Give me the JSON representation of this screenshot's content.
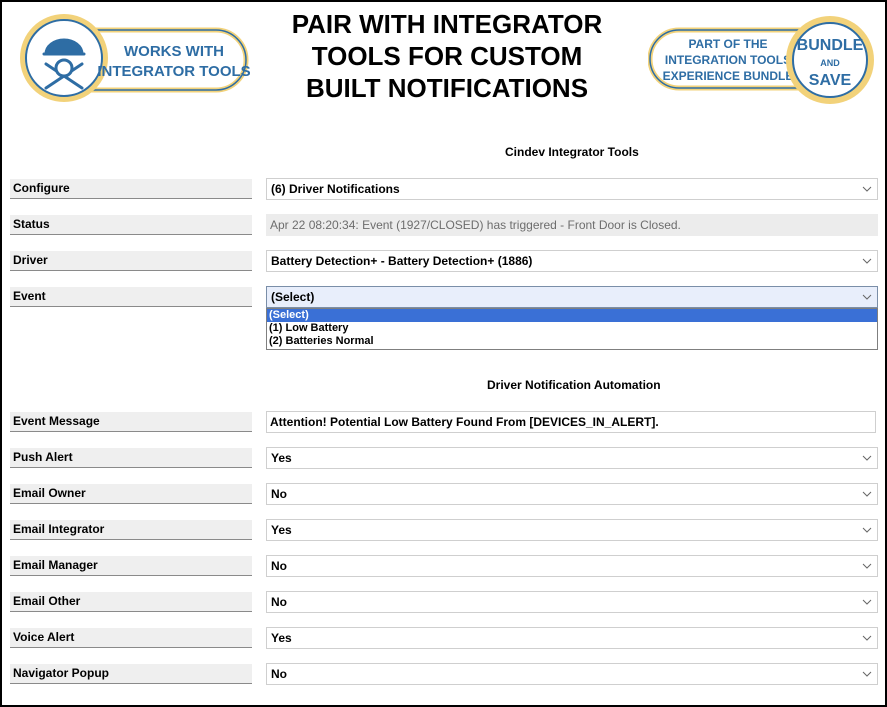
{
  "header": {
    "headline_lines": [
      "PAIR WITH INTEGRATOR",
      "TOOLS FOR CUSTOM",
      "BUILT NOTIFICATIONS"
    ],
    "left_badge": {
      "line1": "WORKS WITH",
      "line2": "INTEGRATOR TOOLS",
      "icon": "helmet-wrench-icon"
    },
    "right_badge": {
      "line1": "PART OF THE",
      "line2": "INTEGRATION TOOLS",
      "line3": "EXPERIENCE BUNDLE",
      "seal_line1": "BUNDLE",
      "seal_line2": "AND",
      "seal_line3": "SAVE"
    }
  },
  "section1_title": "Cindev Integrator Tools",
  "section2_title": "Driver Notification Automation",
  "rows": {
    "configure": {
      "label": "Configure",
      "value": "(6) Driver Notifications"
    },
    "status": {
      "label": "Status",
      "value": "Apr 22 08:20:34: Event (1927/CLOSED) has triggered - Front Door is Closed."
    },
    "driver": {
      "label": "Driver",
      "value": "Battery Detection+ - Battery Detection+ (1886)"
    },
    "event": {
      "label": "Event",
      "value": "(Select)"
    },
    "event_message": {
      "label": "Event Message",
      "value": "Attention!  Potential Low Battery Found From [DEVICES_IN_ALERT]."
    },
    "push_alert": {
      "label": "Push Alert",
      "value": "Yes"
    },
    "email_owner": {
      "label": "Email Owner",
      "value": "No"
    },
    "email_integrator": {
      "label": "Email Integrator",
      "value": "Yes"
    },
    "email_manager": {
      "label": "Email Manager",
      "value": "No"
    },
    "email_other": {
      "label": "Email Other",
      "value": "No"
    },
    "voice_alert": {
      "label": "Voice Alert",
      "value": "Yes"
    },
    "navigator_popup": {
      "label": "Navigator Popup",
      "value": "No"
    }
  },
  "event_options": [
    "(Select)",
    "(1) Low Battery",
    "(2) Batteries Normal"
  ],
  "colors": {
    "badge_blue": "#2e6da4",
    "badge_gold": "#f2d27a",
    "selection_blue": "#3a70d6"
  }
}
